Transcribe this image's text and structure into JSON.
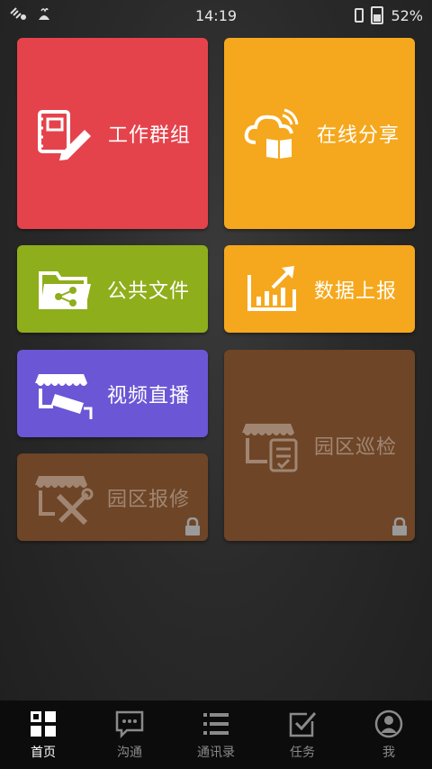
{
  "status_bar": {
    "time": "14:19",
    "battery": "52%",
    "left_icons": [
      "signal-icon",
      "notification-icon"
    ]
  },
  "tiles": [
    {
      "label": "工作群组",
      "icon": "notebook-pen-icon",
      "color": "#e5434c",
      "locked": false
    },
    {
      "label": "在线分享",
      "icon": "cloud-book-icon",
      "color": "#f5a81d",
      "locked": false
    },
    {
      "label": "公共文件",
      "icon": "shared-folder-icon",
      "color": "#8fae1b",
      "locked": false
    },
    {
      "label": "数据上报",
      "icon": "chart-upload-icon",
      "color": "#f5a81d",
      "locked": false
    },
    {
      "label": "视频直播",
      "icon": "camera-store-icon",
      "color": "#6b56d5",
      "locked": false
    },
    {
      "label": "园区巡检",
      "icon": "store-checklist-icon",
      "color": "#6e4527",
      "locked": true
    },
    {
      "label": "园区报修",
      "icon": "store-tools-icon",
      "color": "#6e4527",
      "locked": true
    }
  ],
  "nav": [
    {
      "label": "首页",
      "icon": "home-grid-icon",
      "active": true
    },
    {
      "label": "沟通",
      "icon": "chat-bubble-icon",
      "active": false
    },
    {
      "label": "通讯录",
      "icon": "list-icon",
      "active": false
    },
    {
      "label": "任务",
      "icon": "checkbox-icon",
      "active": false
    },
    {
      "label": "我",
      "icon": "profile-icon",
      "active": false
    }
  ]
}
